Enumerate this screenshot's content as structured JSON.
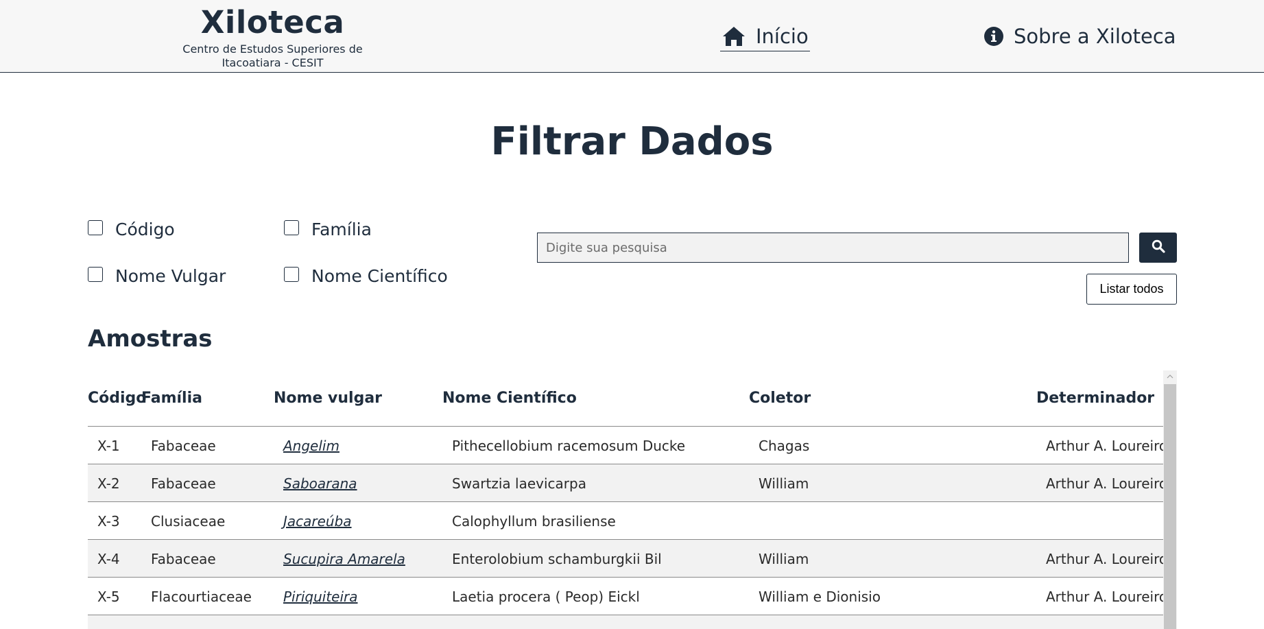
{
  "header": {
    "brand_title": "Xiloteca",
    "brand_subtitle_line1": "Centro de Estudos Superiores de",
    "brand_subtitle_line2": "Itacoatiara - CESIT",
    "nav_home_label": "Início",
    "nav_about_label": "Sobre a Xiloteca",
    "nav_home_icon": "home-icon",
    "nav_about_icon": "info-icon"
  },
  "page_title": "Filtrar Dados",
  "filters": {
    "codigo": "Código",
    "familia": "Família",
    "nome_vulgar": "Nome Vulgar",
    "nome_cientifico": "Nome Científico"
  },
  "search": {
    "placeholder": "Digite sua pesquisa",
    "button_icon": "search-icon",
    "list_all_label": "Listar todos"
  },
  "section_title": "Amostras",
  "table": {
    "columns": [
      "Código",
      "Família",
      "Nome vulgar",
      "Nome Científico",
      "Coletor",
      "Determinador"
    ],
    "rows": [
      {
        "codigo": "X-1",
        "familia": "Fabaceae",
        "nome_vulgar": "Angelim",
        "nome_cientifico": "Pithecellobium racemosum Ducke",
        "coletor": "Chagas",
        "determinador": "Arthur A. Loureiro"
      },
      {
        "codigo": "X-2",
        "familia": "Fabaceae",
        "nome_vulgar": "Saboarana",
        "nome_cientifico": "Swartzia laevicarpa",
        "coletor": "William",
        "determinador": "Arthur A. Loureiro"
      },
      {
        "codigo": "X-3",
        "familia": "Clusiaceae",
        "nome_vulgar": "Jacareúba",
        "nome_cientifico": "Calophyllum brasiliense",
        "coletor": "",
        "determinador": ""
      },
      {
        "codigo": "X-4",
        "familia": "Fabaceae",
        "nome_vulgar": "Sucupira Amarela",
        "nome_cientifico": "Enterolobium schamburgkii Bil",
        "coletor": "William",
        "determinador": "Arthur A. Loureiro"
      },
      {
        "codigo": "X-5",
        "familia": "Flacourtiaceae",
        "nome_vulgar": "Piriquiteira",
        "nome_cientifico": "Laetia procera ( Peop) Eickl",
        "coletor": "William e Dionisio",
        "determinador": "Arthur A. Loureiro"
      }
    ]
  },
  "colors": {
    "primary": "#1f2d3d",
    "header_bg": "#f7f7f7",
    "row_alt_bg": "#f2f2f2"
  }
}
